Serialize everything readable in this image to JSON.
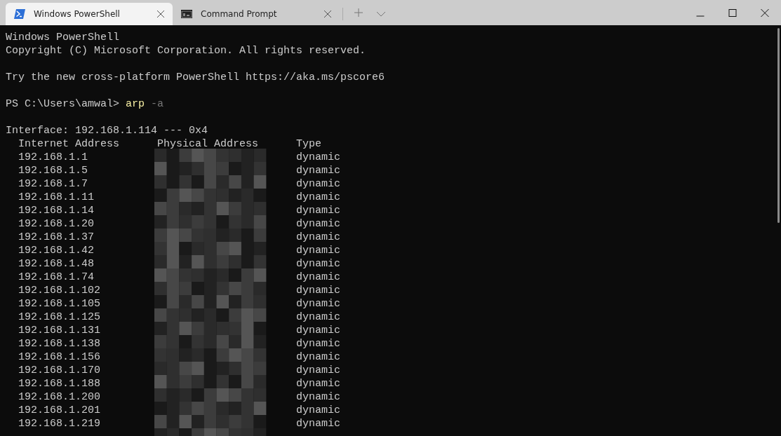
{
  "tabs": [
    {
      "title": "Windows PowerShell",
      "kind": "powershell",
      "selected": true
    },
    {
      "title": "Command Prompt",
      "kind": "cmd",
      "selected": false
    }
  ],
  "console": {
    "banner": [
      [
        "Windows PowerShell",
        "Copyright (C) Microsoft Corporation. All rights reserved."
      ],
      [
        "Try the new cross-platform PowerShell https://aka.ms/pscore6"
      ]
    ],
    "prompt": {
      "path": "PS C:\\Users\\amwal>",
      "command": "arp",
      "args": "-a"
    },
    "interface": "Interface: 192.168.1.114 --- 0x4",
    "columns": [
      "Internet Address",
      "Physical Address",
      "Type"
    ],
    "rows": [
      {
        "internet_address": "192.168.1.1",
        "type": "dynamic"
      },
      {
        "internet_address": "192.168.1.5",
        "type": "dynamic"
      },
      {
        "internet_address": "192.168.1.7",
        "type": "dynamic"
      },
      {
        "internet_address": "192.168.1.11",
        "type": "dynamic"
      },
      {
        "internet_address": "192.168.1.14",
        "type": "dynamic"
      },
      {
        "internet_address": "192.168.1.20",
        "type": "dynamic"
      },
      {
        "internet_address": "192.168.1.37",
        "type": "dynamic"
      },
      {
        "internet_address": "192.168.1.42",
        "type": "dynamic"
      },
      {
        "internet_address": "192.168.1.48",
        "type": "dynamic"
      },
      {
        "internet_address": "192.168.1.74",
        "type": "dynamic"
      },
      {
        "internet_address": "192.168.1.102",
        "type": "dynamic"
      },
      {
        "internet_address": "192.168.1.105",
        "type": "dynamic"
      },
      {
        "internet_address": "192.168.1.125",
        "type": "dynamic"
      },
      {
        "internet_address": "192.168.1.131",
        "type": "dynamic"
      },
      {
        "internet_address": "192.168.1.138",
        "type": "dynamic"
      },
      {
        "internet_address": "192.168.1.156",
        "type": "dynamic"
      },
      {
        "internet_address": "192.168.1.170",
        "type": "dynamic"
      },
      {
        "internet_address": "192.168.1.188",
        "type": "dynamic"
      },
      {
        "internet_address": "192.168.1.200",
        "type": "dynamic"
      },
      {
        "internet_address": "192.168.1.201",
        "type": "dynamic"
      },
      {
        "internet_address": "192.168.1.219",
        "type": "dynamic"
      }
    ]
  }
}
